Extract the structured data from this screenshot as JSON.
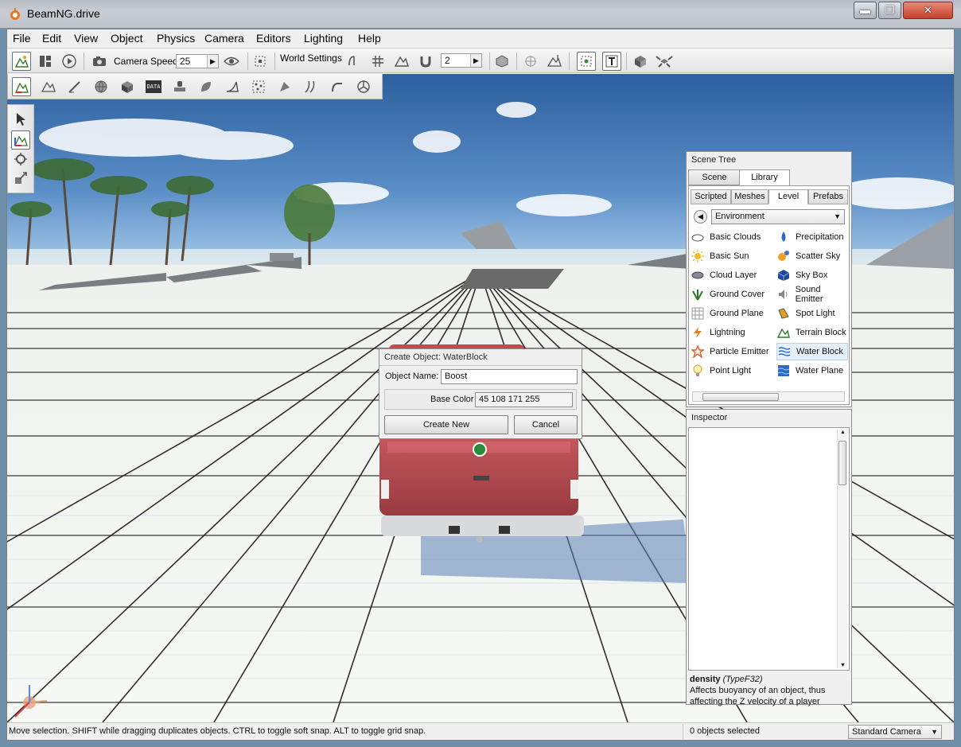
{
  "window": {
    "title": "BeamNG.drive",
    "minimize_glyph": "▬",
    "maximize_glyph": "❐",
    "close_glyph": "✕"
  },
  "menu": [
    "File",
    "Edit",
    "View",
    "Object",
    "Physics",
    "Camera",
    "Editors",
    "Lighting",
    "Help"
  ],
  "toolbar": {
    "camera_speed_label": "Camera Speed",
    "camera_speed_value": "25",
    "world_settings_label": "World Settings",
    "snap_value": "2",
    "data_label": "DATA"
  },
  "scene_tree": {
    "title": "Scene Tree",
    "tabs": [
      "Scene",
      "Library"
    ],
    "active_tab": "Library",
    "subtabs": [
      "Scripted",
      "Meshes",
      "Level",
      "Prefabs"
    ],
    "active_subtab": "Level",
    "category": "Environment",
    "items_left": [
      "Basic Clouds",
      "Basic Sun",
      "Cloud Layer",
      "Ground Cover",
      "Ground Plane",
      "Lightning",
      "Particle Emitter",
      "Point Light"
    ],
    "items_right": [
      "Precipitation",
      "Scatter Sky",
      "Sky Box",
      "Sound Emitter",
      "Spot Light",
      "Terrain Block",
      "Water Block",
      "Water Plane"
    ],
    "selected_item": "Water Block"
  },
  "inspector": {
    "title": "Inspector",
    "field_name": "density",
    "field_type": "(TypeF32)",
    "help_text": "Affects buoyancy of an object, thus affecting the Z velocity of a player"
  },
  "dialog": {
    "title": "Create Object: WaterBlock",
    "object_name_label": "Object Name:",
    "object_name_value": "Boost",
    "base_color_label": "Base Color",
    "base_color_value": "45 108 171 255",
    "create_label": "Create New",
    "cancel_label": "Cancel"
  },
  "status": {
    "message": "Move selection.  SHIFT while dragging duplicates objects.  CTRL to toggle soft snap.  ALT to toggle grid snap.",
    "selection": "0 objects selected",
    "camera": "Standard Camera"
  },
  "colors": {
    "accent": "#2d6cab",
    "truck": "#b5484e",
    "sky": "#5b8ec7"
  }
}
